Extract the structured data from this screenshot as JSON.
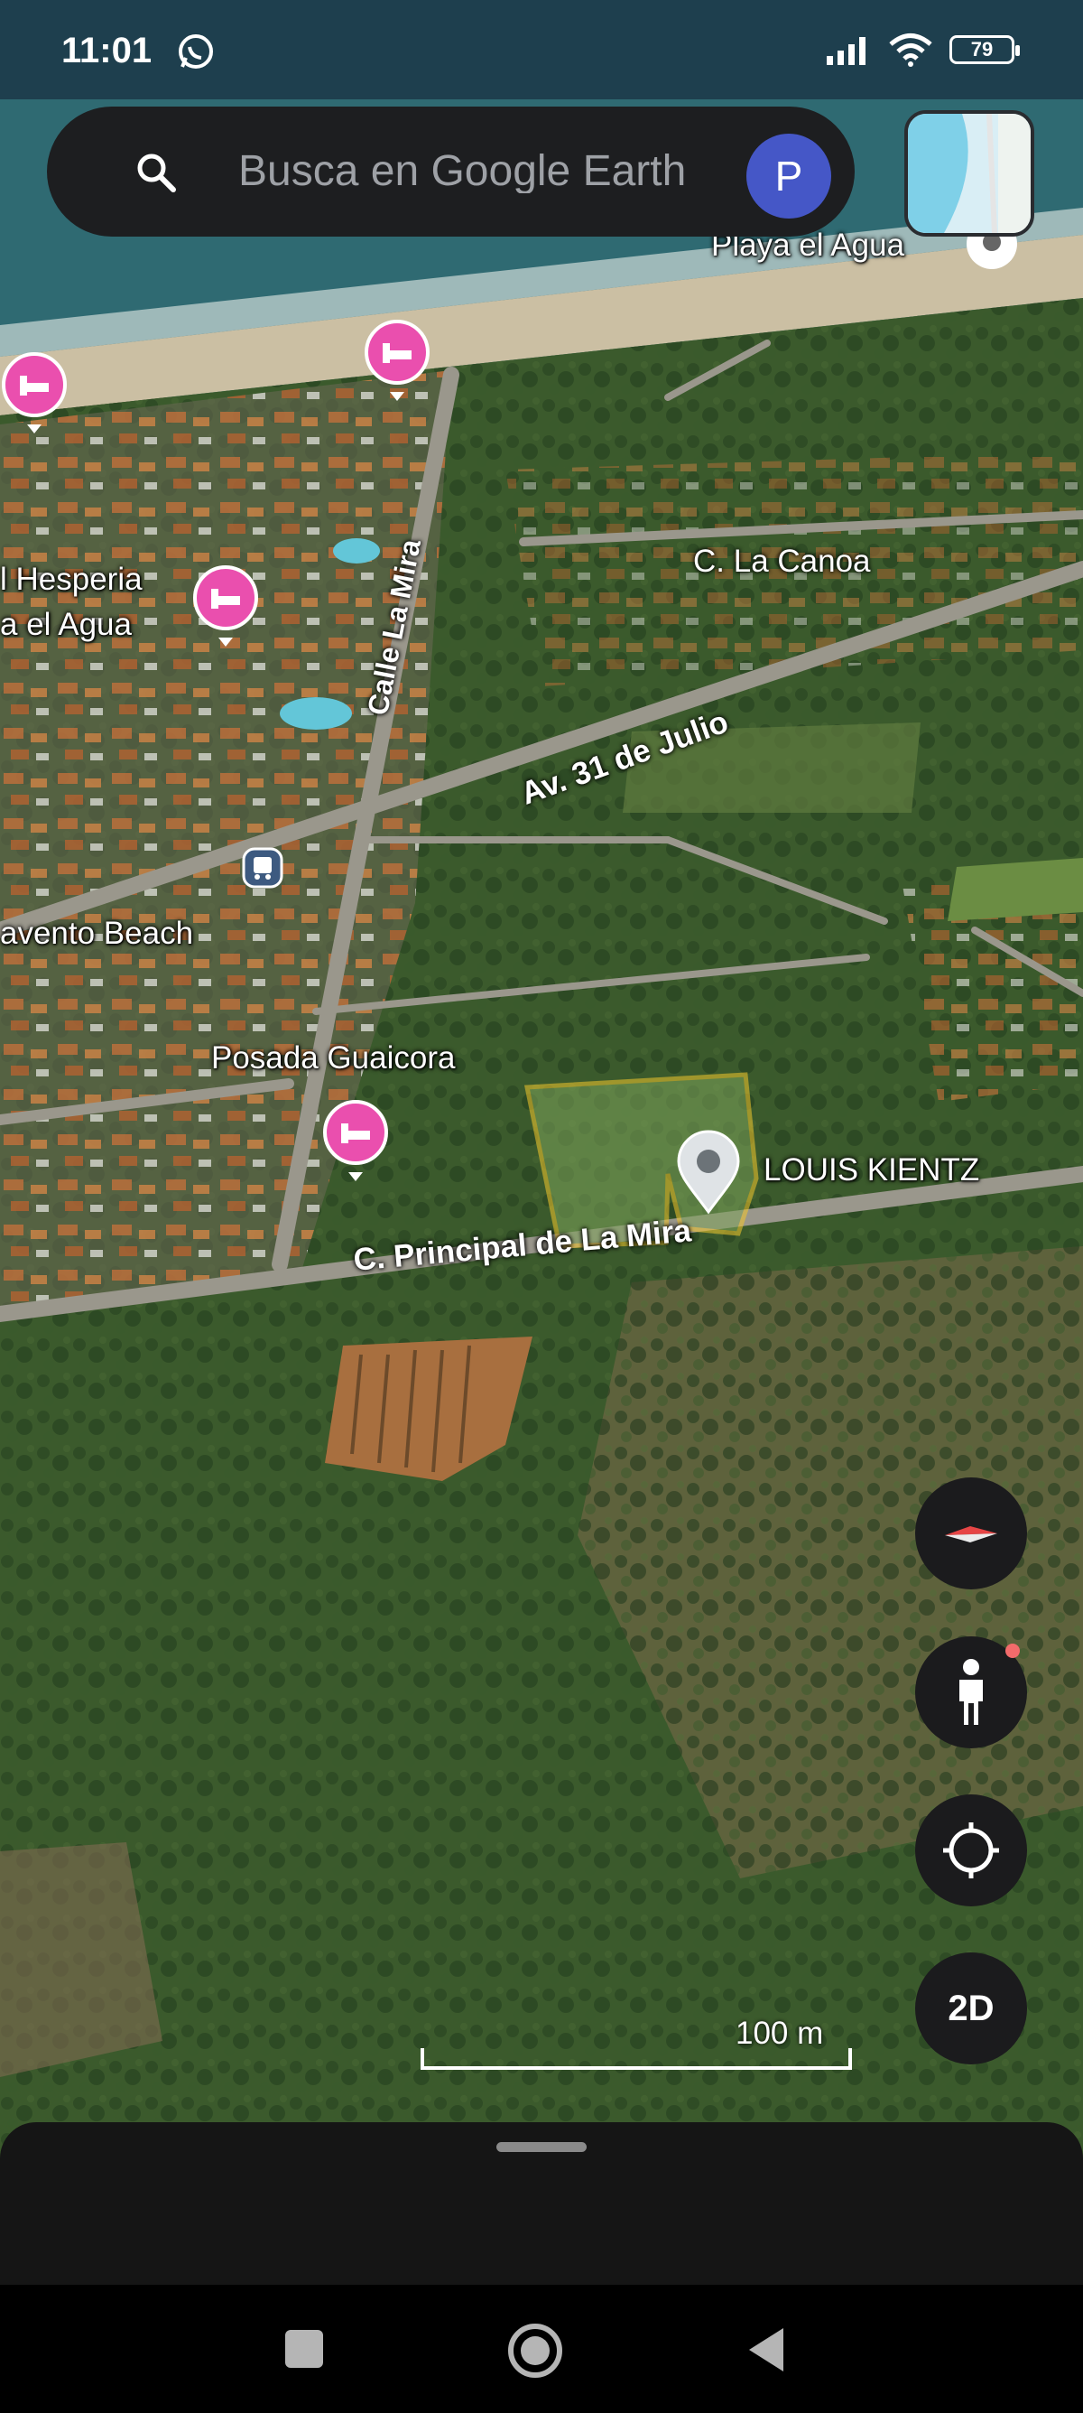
{
  "status_bar": {
    "time": "11:01",
    "battery": "79",
    "icons": [
      "whatsapp-icon",
      "signal-icon",
      "wifi-icon",
      "battery-icon"
    ]
  },
  "search": {
    "placeholder": "Busca en Google Earth",
    "avatar_letter": "P"
  },
  "map_labels": {
    "playa_el_agua": "Playa el Agua",
    "hesperia_line1": "l Hesperia",
    "hesperia_line2": "a el Agua",
    "barlovento": "avento Beach",
    "posada": "Posada Guaicora",
    "louis": "LOUIS KIENTZ"
  },
  "roads": {
    "calle_la_mira": "Calle La Mira",
    "av_31_julio": "Av. 31 de Julio",
    "c_la_canoa": "C. La Canoa",
    "principal": "C. Principal de La Mira"
  },
  "controls": {
    "view_mode": "2D",
    "icons": [
      "compass-icon",
      "pegman-icon",
      "my-location-icon"
    ]
  },
  "scale": {
    "label": "100 m"
  },
  "nav": {
    "icons": [
      "recents-icon",
      "home-icon",
      "back-icon"
    ]
  },
  "colors": {
    "sea": "#3f7f86",
    "hotel_pin": "#ea4fae",
    "avatar": "#4557c7",
    "parcel_outline": "#f3c72d",
    "panel": "#1d1e20"
  }
}
